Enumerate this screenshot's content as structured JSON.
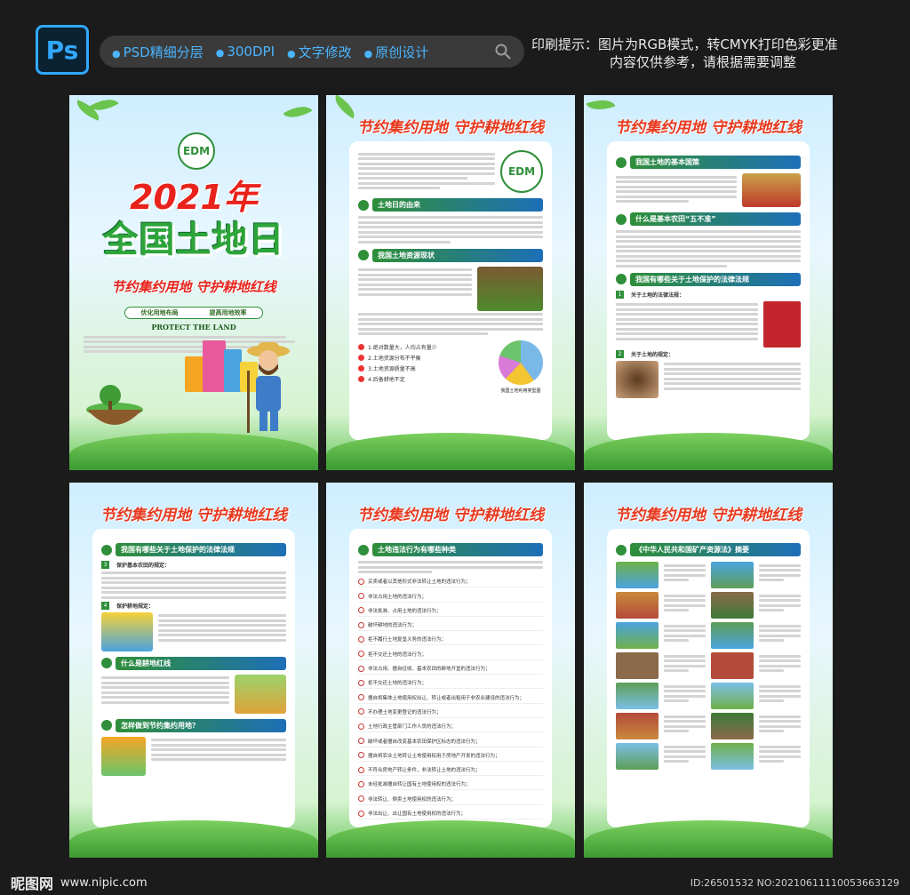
{
  "header": {
    "app_icon": "Ps",
    "features": [
      "PSD精细分层",
      "300DPI",
      "文字修改",
      "原创设计"
    ],
    "print_tip_line1": "印刷提示：图片为RGB模式，转CMYK打印色彩更准",
    "print_tip_line2": "内容仅供参考，请根据需要调整"
  },
  "panel_title": "节约集约用地 守护耕地红线",
  "cover": {
    "logo_text": "EDM",
    "year": "2021年",
    "main_title": "全国土地日",
    "slogan": "节约集约用地 守护耕地红线",
    "band_left": "优化用地布局",
    "band_right": "提高用地效率",
    "english": "PROTECT THE LAND"
  },
  "panel2": {
    "sections": [
      "土地日的由来",
      "我国土地资源现状"
    ],
    "bullets": [
      "1.绝对数量大，人均占有量少",
      "2.土地资源分布不平衡",
      "3.土地资源质量不高",
      "4.后备耕地不足"
    ],
    "chart_caption": "我国土地利用类型图"
  },
  "panel3": {
    "sections": [
      "我国土地的基本国策",
      "什么是基本农田“五不准”",
      "我国有哪些关于土地保护的法律法规"
    ],
    "subheads": [
      "关于土地的法律法规：",
      "关于土地的规定："
    ]
  },
  "panel4": {
    "sections": [
      "我国有哪些关于土地保护的法律法规",
      "什么是耕地红线",
      "怎样做到节约集约用地？"
    ],
    "subheads": [
      "保护基本农田的规定：",
      "保护耕地规定："
    ]
  },
  "panel5": {
    "section": "土地违法行为有哪些种类",
    "items": [
      "买卖或者以其他形式非法转让土地的违法行为；",
      "非法占用土地的违法行为；",
      "非法批准、占用土地的违法行为；",
      "破坏耕地的违法行为；",
      "拒不履行土地复垦义务的违法行为；",
      "拒不交还土地的违法行为；",
      "非法占用、擅自征收、基本农田的耕地开垦的违法行为；",
      "拒不交还土地的违法行为；",
      "擅自将集体土地使用权出让、转让或者出租用于非农业建设的违法行为；",
      "不办理土地变更登记的违法行为；",
      "土地行政主管部门工作人员的违法行为；",
      "破坏或者擅自改变基本农田保护区标志的违法行为；",
      "擅自将农业土地转让土地使用权用于房地产开发的违法行为；",
      "不符合房地产转让条件，非法转让土地的违法行为；",
      "未经批准擅自转让国有土地使用权的违法行为；",
      "非法转让、倒卖土地使用权的违法行为；",
      "非法出让、出让国有土地使用权的违法行为；"
    ]
  },
  "panel6": {
    "section": "《中华人民共和国矿产资源法》摘要"
  },
  "footer": {
    "brand": "昵图网",
    "url": "www.nipic.com",
    "id_text": "ID:26501532 NO:20210611110053663129"
  }
}
